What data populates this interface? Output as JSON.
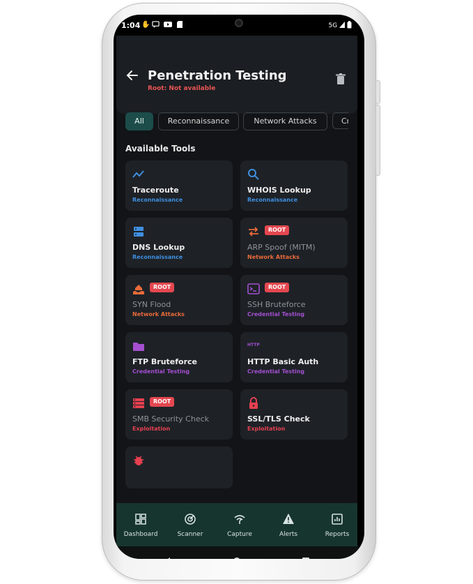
{
  "status_bar": {
    "time": "1:04",
    "notification_icons": [
      "hand-icon",
      "chat-icon",
      "youtube-icon",
      "sim-icon"
    ],
    "network": "5G"
  },
  "header": {
    "title": "Penetration Testing",
    "subtitle": "Root: Not available"
  },
  "filters": [
    {
      "label": "All",
      "active": true
    },
    {
      "label": "Reconnaissance",
      "active": false
    },
    {
      "label": "Network Attacks",
      "active": false
    },
    {
      "label": "Cr",
      "active": false
    }
  ],
  "section_title": "Available Tools",
  "tools": [
    {
      "name": "Traceroute",
      "category": "Reconnaissance",
      "icon": "trend-line-icon",
      "root": false
    },
    {
      "name": "WHOIS Lookup",
      "category": "Reconnaissance",
      "icon": "search-icon",
      "root": false
    },
    {
      "name": "DNS Lookup",
      "category": "Reconnaissance",
      "icon": "dns-server-icon",
      "root": false
    },
    {
      "name": "ARP Spoof (MITM)",
      "category": "Network Attacks",
      "icon": "swap-arrows-icon",
      "root": true
    },
    {
      "name": "SYN Flood",
      "category": "Network Attacks",
      "icon": "flood-icon",
      "root": true
    },
    {
      "name": "SSH Bruteforce",
      "category": "Credential Testing",
      "icon": "terminal-icon",
      "root": true
    },
    {
      "name": "FTP Bruteforce",
      "category": "Credential Testing",
      "icon": "folder-icon",
      "root": false
    },
    {
      "name": "HTTP Basic Auth",
      "category": "Credential Testing",
      "icon": "http-icon",
      "root": false
    },
    {
      "name": "SMB Security Check",
      "category": "Exploitation",
      "icon": "server-list-icon",
      "root": true
    },
    {
      "name": "SSL/TLS Check",
      "category": "Exploitation",
      "icon": "lock-icon",
      "root": false
    },
    {
      "name": "",
      "category": "",
      "icon": "bug-icon",
      "root": false
    }
  ],
  "root_badge": "ROOT",
  "http_icon_text": "HTTP",
  "colors": {
    "Reconnaissance": "#3f8fe0",
    "Network Attacks": "#ea6a3a",
    "Credential Testing": "#a44fd0",
    "Exploitation": "#e64050",
    "accent": "#1c4d4a"
  },
  "bottom_nav": [
    {
      "label": "Dashboard",
      "icon": "dashboard-icon"
    },
    {
      "label": "Scanner",
      "icon": "radar-icon"
    },
    {
      "label": "Capture",
      "icon": "wifi-capture-icon"
    },
    {
      "label": "Alerts",
      "icon": "warning-icon"
    },
    {
      "label": "Reports",
      "icon": "report-icon"
    }
  ]
}
